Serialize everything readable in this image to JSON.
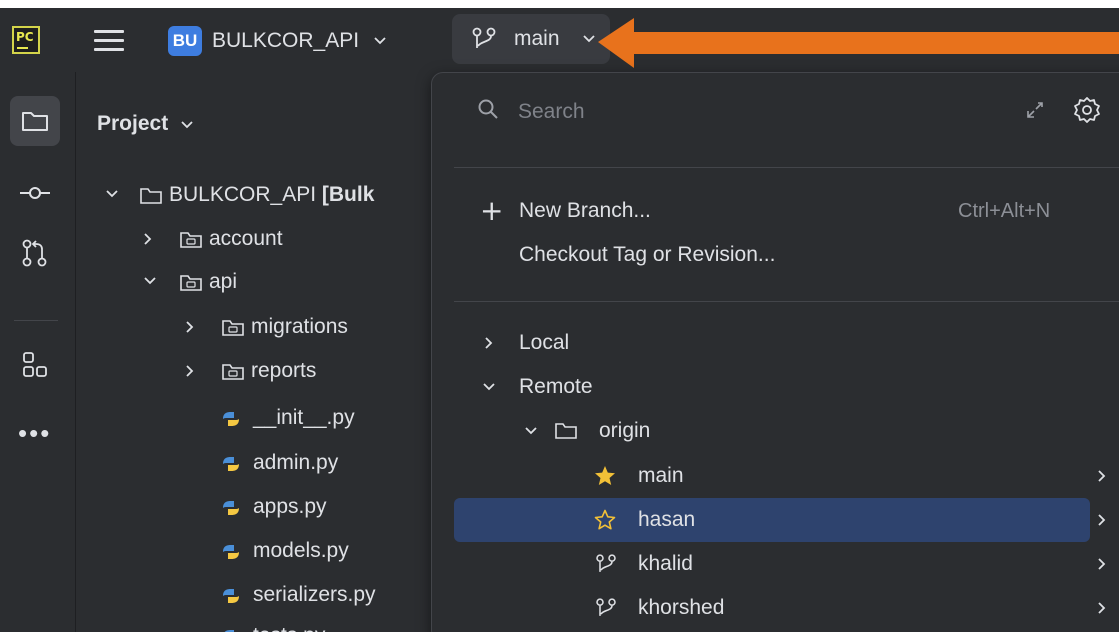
{
  "titlebar": {
    "logo_text": "PC",
    "project_badge": "BU",
    "project_name": "BULKCOR_API",
    "branch": "main"
  },
  "toolstrip": {
    "items": [
      "folder-icon",
      "commit-icon",
      "pull-requests-icon",
      "structure-icon",
      "more-icon"
    ],
    "more_label": "•••"
  },
  "project_panel": {
    "header": "Project",
    "tree": [
      {
        "label": "BULKCOR_API [Bulk",
        "bold_suffix": true,
        "type": "folder",
        "expanded": true,
        "depth": 0
      },
      {
        "label": "account",
        "type": "module",
        "expanded": false,
        "depth": 1
      },
      {
        "label": "api",
        "type": "module",
        "expanded": true,
        "depth": 1
      },
      {
        "label": "migrations",
        "type": "module",
        "expanded": false,
        "depth": 2
      },
      {
        "label": "reports",
        "type": "module",
        "expanded": false,
        "depth": 2
      },
      {
        "label": "__init__.py",
        "type": "python",
        "depth": 2
      },
      {
        "label": "admin.py",
        "type": "python",
        "depth": 2
      },
      {
        "label": "apps.py",
        "type": "python",
        "depth": 2
      },
      {
        "label": "models.py",
        "type": "python",
        "depth": 2
      },
      {
        "label": "serializers.py",
        "type": "python",
        "depth": 2
      },
      {
        "label": "tests.py",
        "type": "python",
        "depth": 2
      }
    ]
  },
  "branch_popup": {
    "search_placeholder": "Search",
    "new_branch_label": "New Branch...",
    "new_branch_shortcut": "Ctrl+Alt+N",
    "checkout_label": "Checkout Tag or Revision...",
    "local_label": "Local",
    "remote_label": "Remote",
    "origin_label": "origin",
    "branches": [
      {
        "name": "main",
        "icon": "star-filled-icon",
        "selected": false
      },
      {
        "name": "hasan",
        "icon": "star-outline-icon",
        "selected": true
      },
      {
        "name": "khalid",
        "icon": "branch-icon",
        "selected": false
      },
      {
        "name": "khorshed",
        "icon": "branch-icon",
        "selected": false
      }
    ]
  },
  "colors": {
    "background": "#2b2d30",
    "selection": "#2e436e",
    "accent_blue": "#3e7de0",
    "arrow_orange": "#e8721c",
    "star_yellow": "#f2c037",
    "python_blue": "#4a8fd8",
    "python_yellow": "#f5c842"
  }
}
